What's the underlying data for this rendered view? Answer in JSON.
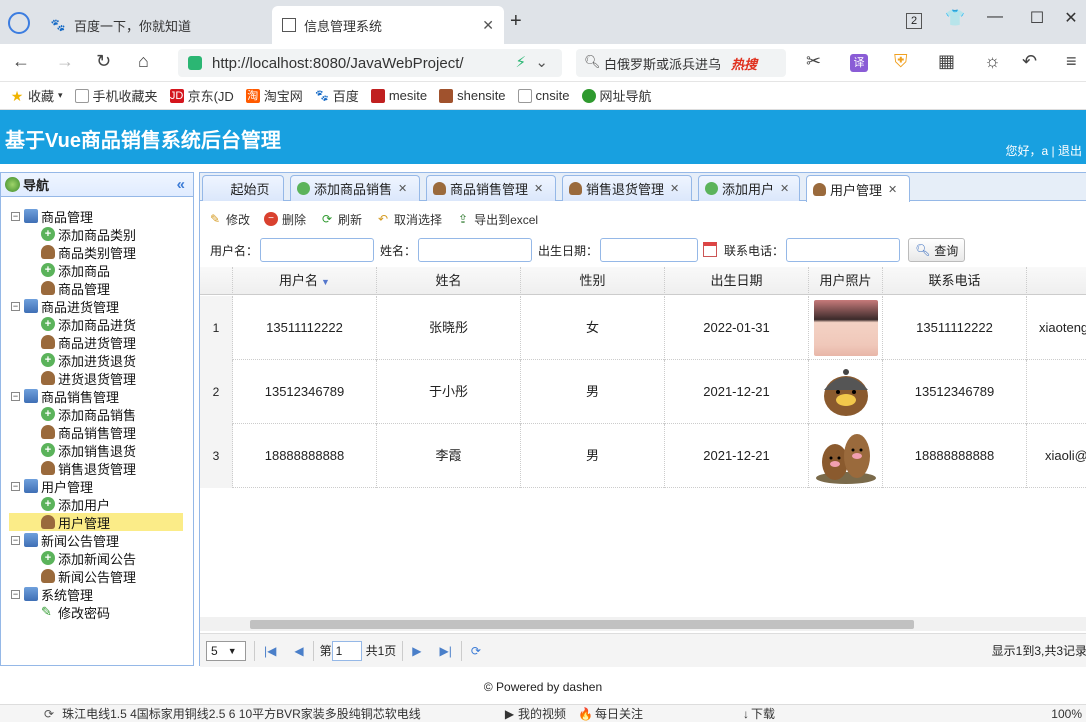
{
  "browser": {
    "tabs": [
      {
        "title": "百度一下，你就知道",
        "active": false
      },
      {
        "title": "信息管理系统",
        "active": true
      }
    ],
    "tab_count": "2",
    "url": "http://localhost:8080/JavaWebProject/",
    "search_text": "白俄罗斯或派兵进乌",
    "hot_label": "热搜",
    "bookmarks": [
      "收藏",
      "手机收藏夹",
      "京东(JD",
      "淘宝网",
      "百度",
      "mesite",
      "shensite",
      "cnsite",
      "网址导航"
    ]
  },
  "app": {
    "title": "基于Vue商品销售系统后台管理",
    "greeting": "您好，a | 退出",
    "footer": "© Powered by dashen"
  },
  "nav": {
    "title": "导航",
    "groups": [
      {
        "label": "商品管理",
        "items": [
          {
            "label": "添加商品类别",
            "icon": "add"
          },
          {
            "label": "商品类别管理",
            "icon": "user"
          },
          {
            "label": "添加商品",
            "icon": "add"
          },
          {
            "label": "商品管理",
            "icon": "user"
          }
        ]
      },
      {
        "label": "商品进货管理",
        "items": [
          {
            "label": "添加商品进货",
            "icon": "add"
          },
          {
            "label": "商品进货管理",
            "icon": "user"
          },
          {
            "label": "添加进货退货",
            "icon": "add"
          },
          {
            "label": "进货退货管理",
            "icon": "user"
          }
        ]
      },
      {
        "label": "商品销售管理",
        "items": [
          {
            "label": "添加商品销售",
            "icon": "add"
          },
          {
            "label": "商品销售管理",
            "icon": "user"
          },
          {
            "label": "添加销售退货",
            "icon": "add"
          },
          {
            "label": "销售退货管理",
            "icon": "user"
          }
        ]
      },
      {
        "label": "用户管理",
        "items": [
          {
            "label": "添加用户",
            "icon": "add"
          },
          {
            "label": "用户管理",
            "icon": "user",
            "selected": true
          }
        ]
      },
      {
        "label": "新闻公告管理",
        "items": [
          {
            "label": "添加新闻公告",
            "icon": "add"
          },
          {
            "label": "新闻公告管理",
            "icon": "user"
          }
        ]
      },
      {
        "label": "系统管理",
        "items": [
          {
            "label": "修改密码",
            "icon": "edit"
          }
        ]
      }
    ]
  },
  "main_tabs": [
    {
      "label": "起始页",
      "closable": false
    },
    {
      "label": "添加商品销售",
      "closable": true
    },
    {
      "label": "商品销售管理",
      "closable": true
    },
    {
      "label": "销售退货管理",
      "closable": true
    },
    {
      "label": "添加用户",
      "closable": true
    },
    {
      "label": "用户管理",
      "closable": true,
      "active": true
    }
  ],
  "toolbar": {
    "edit": "修改",
    "delete": "删除",
    "refresh": "刷新",
    "cancel_select": "取消选择",
    "export": "导出到excel"
  },
  "search_form": {
    "username_label": "用户名：",
    "name_label": "姓名：",
    "birth_label": "出生日期：",
    "phone_label": "联系电话：",
    "query_button": "查询"
  },
  "grid": {
    "columns": [
      "用户名",
      "姓名",
      "性别",
      "出生日期",
      "用户照片",
      "联系电话"
    ],
    "rows": [
      {
        "num": "1",
        "username": "13511112222",
        "name": "张晓彤",
        "gender": "女",
        "birth": "2022-01-31",
        "photo": "girl-photo",
        "phone": "13511112222",
        "extra": "xiaoteng"
      },
      {
        "num": "2",
        "username": "13512346789",
        "name": "于小彤",
        "gender": "男",
        "birth": "2021-12-21",
        "photo": "cartoon-mole-photo",
        "phone": "13512346789",
        "extra": ""
      },
      {
        "num": "3",
        "username": "18888888888",
        "name": "李霞",
        "gender": "男",
        "birth": "2021-12-21",
        "photo": "cartoon-moles-photo",
        "phone": "18888888888",
        "extra": "xiaoli@"
      }
    ]
  },
  "pager": {
    "page_size": "5",
    "page_label": "第",
    "page_value": "1",
    "total_pages": "共1页",
    "summary": "显示1到3,共3记录"
  },
  "statusbar": {
    "news": "珠江电线1.5 4国标家用铜线2.5 6 10平方BVR家装多股纯铜芯软电线",
    "my_video": "我的视频",
    "daily": "每日关注",
    "download": "下载",
    "zoom": "100%"
  },
  "colors": {
    "header_bg": "#18a0e0",
    "panel_border": "#95b8e7",
    "selected_node": "#fbec88"
  }
}
